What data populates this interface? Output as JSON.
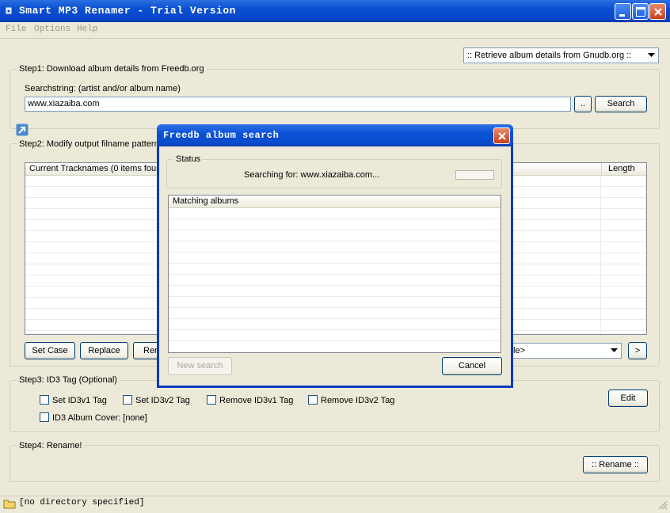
{
  "window": {
    "title": "Smart MP3 Renamer - Trial Version"
  },
  "menu": [
    "File",
    "Options",
    "Help"
  ],
  "source_select": {
    "value": ":: Retrieve album details from Gnudb.org ::"
  },
  "step1": {
    "legend": "Step1: Download album details from Freedb.org",
    "search_label": "Searchstring: (artist and/or album name)",
    "search_value": "www.xiazaiba.com",
    "browse_label": "..",
    "search_button": "Search"
  },
  "step2": {
    "legend": "Step2: Modify output filname pattern",
    "columns": [
      "Current Tracknames (0 items found)",
      "Length"
    ],
    "buttons": [
      "Set Case",
      "Replace",
      "Ren"
    ],
    "pattern_value": "tle>",
    "next_label": ">"
  },
  "step3": {
    "legend": "Step3: ID3 Tag (Optional)",
    "checkboxes": [
      "Set ID3v1 Tag",
      "Set ID3v2 Tag",
      "Remove ID3v1 Tag",
      "Remove ID3v2 Tag",
      "ID3 Album Cover: [none]"
    ],
    "edit_button": "Edit"
  },
  "step4": {
    "legend": "Step4: Rename!",
    "rename_button": ":: Rename ::"
  },
  "statusbar": {
    "text": "[no directory specified]"
  },
  "dialog": {
    "title": "Freedb album search",
    "status_legend": "Status",
    "status_text": "Searching for: www.xiazaiba.com...",
    "list_header": "Matching albums",
    "new_search_button": "New search",
    "cancel_button": "Cancel"
  },
  "colors": {
    "titlebar": "#0a4fd2",
    "close_button": "#c8401c",
    "face": "#ece9d8"
  }
}
